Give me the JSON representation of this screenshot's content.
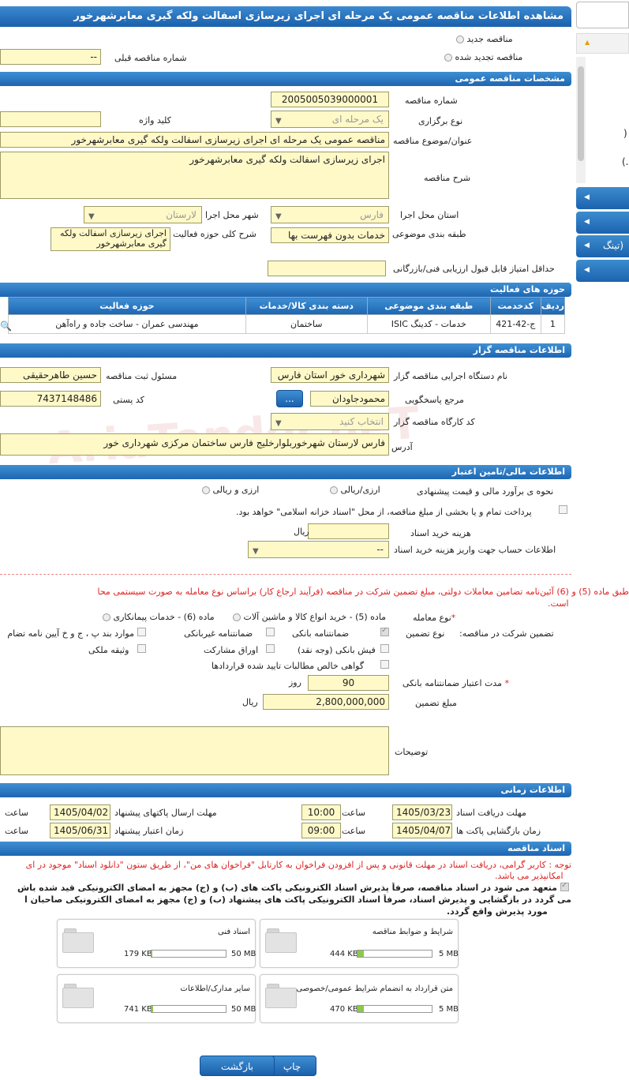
{
  "title": "مشاهده اطلاعات مناقصه عمومی یک مرحله ای اجرای زیرسازی اسفالت ولکه گیری معابرشهرخور",
  "tender_type": {
    "new": "مناقصه جدید",
    "renewed": "مناقصه تجدید شده",
    "prev_label": "شماره مناقصه قبلی",
    "prev_value": "--"
  },
  "general": {
    "header": "مشخصات مناقصه عمومی",
    "number_label": "شماره مناقصه",
    "number": "2005005039000001",
    "type_label": "نوع برگزاری",
    "type_value": "یک مرحله ای",
    "keyword_label": "کلید واژه",
    "subject_label": "عنوان/موضوع مناقصه",
    "subject": "مناقصه عمومی یک مرحله ای اجرای زیرسازی اسفالت ولکه گیری معابرشهرخور",
    "desc_label": "شرح مناقصه",
    "desc": "اجرای زیرسازی اسفالت ولکه گیری معابرشهرخور",
    "province_label": "استان محل اجرا",
    "province": "فارس",
    "city_label": "شهر محل اجرا",
    "city": "لارستان",
    "category_label": "طبقه بندی موضوعی",
    "category": "خدمات بدون فهرست بها",
    "scope_label": "شرح کلی حوزه فعالیت",
    "scope": "اجرای زیرسازی اسفالت ولکه گیری معابرشهرخور",
    "minscore_label": "حداقل امتیاز قابل قبول ارزیابی فنی/بازرگانی"
  },
  "activity": {
    "header": "حوزه های فعالیت",
    "cols": [
      "ردیف",
      "کدخدمت",
      "طبقه بندی موضوعی",
      "دسته بندی کالا/خدمات",
      "حوزه فعالیت"
    ],
    "rows": [
      [
        "1",
        "ج-42-421",
        "خدمات - کدینگ ISIC",
        "ساختمان",
        "مهندسی عمران - ساخت جاده و راه‌آهن"
      ]
    ]
  },
  "org": {
    "header": "اطلاعات مناقصه گزار",
    "name_label": "نام دستگاه اجرایی مناقصه گزار",
    "name": "شهرداری خور استان فارس",
    "resp_label": "مسئول ثبت مناقصه",
    "resp": "حسین  طاهرحقیقی",
    "ref_label": "مرجع پاسخگویی",
    "ref": "محمودجاودان",
    "ref_btn": "...",
    "postal_label": "کد پستی",
    "postal": "7437148486",
    "unit_label": "کد کارگاه مناقصه گزار",
    "unit": "انتخاب کنید",
    "addr_label": "آدرس",
    "addr": "فارس لارستان شهرخوربلوارخلیج فارس ساختمان مرکزی شهرداری خور"
  },
  "finance": {
    "header": "اطلاعات مالی/تامین اعتبار",
    "estimate_label": "نحوه ی برآورد مالی و قیمت پیشنهادی",
    "opt1": "ارزی/ریالی",
    "opt2": "ارزی و ریالی",
    "treasury": "پرداخت تمام و یا بخشی از مبلغ مناقصه، از محل \"اسناد خزانه اسلامی\" خواهد بود.",
    "doc_cost_label": "هزینه خرید اسناد",
    "rial": "ریال",
    "account_label": "اطلاعات حساب جهت واریز هزینه خرید اسناد",
    "account": "--"
  },
  "guarantee": {
    "notice": "طبق ماده (5) و (6) آئین‌نامه تضامین معاملات دولتی، مبلغ تضمین شرکت در مناقصه (فرآیند ارجاع کار) براساس نوع معامله به صورت سیستمی محا",
    "notice2": "است.",
    "deal_label": "نوع معامله",
    "deal1": "ماده (5) - خرید انواع کالا و ماشین آلات",
    "deal2": "ماده (6) - خدمات پیمانکاری",
    "g_label": "تضمین شرکت در مناقصه:",
    "gt_label": "نوع تضمین",
    "g1": "ضمانتنامه بانکی",
    "g2": "ضمانتنامه غیربانکی",
    "g3": "موارد بند پ ، ج و خ آیین نامه تضام",
    "g4": "فیش بانکی (وجه نقد)",
    "g5": "اوراق مشارکت",
    "g6": "وثیقه ملکی",
    "g7": "گواهی خالص مطالبات تایید شده قراردادها",
    "validity_label": "مدت اعتبار ضمانتنامه بانکی",
    "validity": "90",
    "day": "روز",
    "amount_label": "مبلغ تضمین",
    "amount": "2,800,000,000",
    "notes_label": "توضیحات"
  },
  "time": {
    "header": "اطلاعات زمانی",
    "get_label": "مهلت دریافت اسناد",
    "get_date": "1405/03/23",
    "get_time": "10:00",
    "send_label": "مهلت ارسال پاکتهای پیشنهاد",
    "send_date": "1405/04/02",
    "open_label": "زمان بازگشایی پاکت ها",
    "open_date": "1405/04/07",
    "open_time": "09:00",
    "valid_label": "زمان اعتبار پیشنهاد",
    "valid_date": "1405/06/31",
    "time_label": "ساعت"
  },
  "docs": {
    "header": "اسناد مناقصه",
    "note": "توجه : کاربر گرامی، دریافت اسناد در مهلت قانونی و پس از افزودن فراخوان به کارتابل \"فراخوان های من\"، از طریق ستون \"دانلود اسناد\" موجود در ای",
    "note2": "امکانپذیر می باشد.",
    "commit1": "متعهد می شود در اسناد مناقصه، صرفاً پذیرش اسناد الکترونیکی پاکت های (ب) و (ج) مجهز به امضای الکترونیکی قید شده باش",
    "commit2": "می گردد در بازگشایی و پذیرش اسناد، صرفاً اسناد الکترونیکی پاکت های پیشنهاد (ب) و (ج) مجهز به امضای الکترونیکی صاحبان ا",
    "commit3": "مورد پذیرش واقع گردد.",
    "files": [
      {
        "name": "شرایط و ضوابط مناقصه",
        "size": "444 KB",
        "max": "5 MB",
        "fill": 0.09
      },
      {
        "name": "اسناد فنی",
        "size": "179 KB",
        "max": "50 MB",
        "fill": 0.01
      },
      {
        "name": "متن قرارداد به انضمام شرایط عمومی/خصوصی",
        "size": "470 KB",
        "max": "5 MB",
        "fill": 0.09
      },
      {
        "name": "سایر مدارک/اطلاعات",
        "size": "741 KB",
        "max": "50 MB",
        "fill": 0.02
      }
    ]
  },
  "buttons": {
    "print": "چاپ",
    "back": "بازگشت"
  },
  "side": {
    "paren1": ")",
    "paren2": "(.",
    "item": "تینگ)"
  },
  "watermark": "AriaTender.neT"
}
